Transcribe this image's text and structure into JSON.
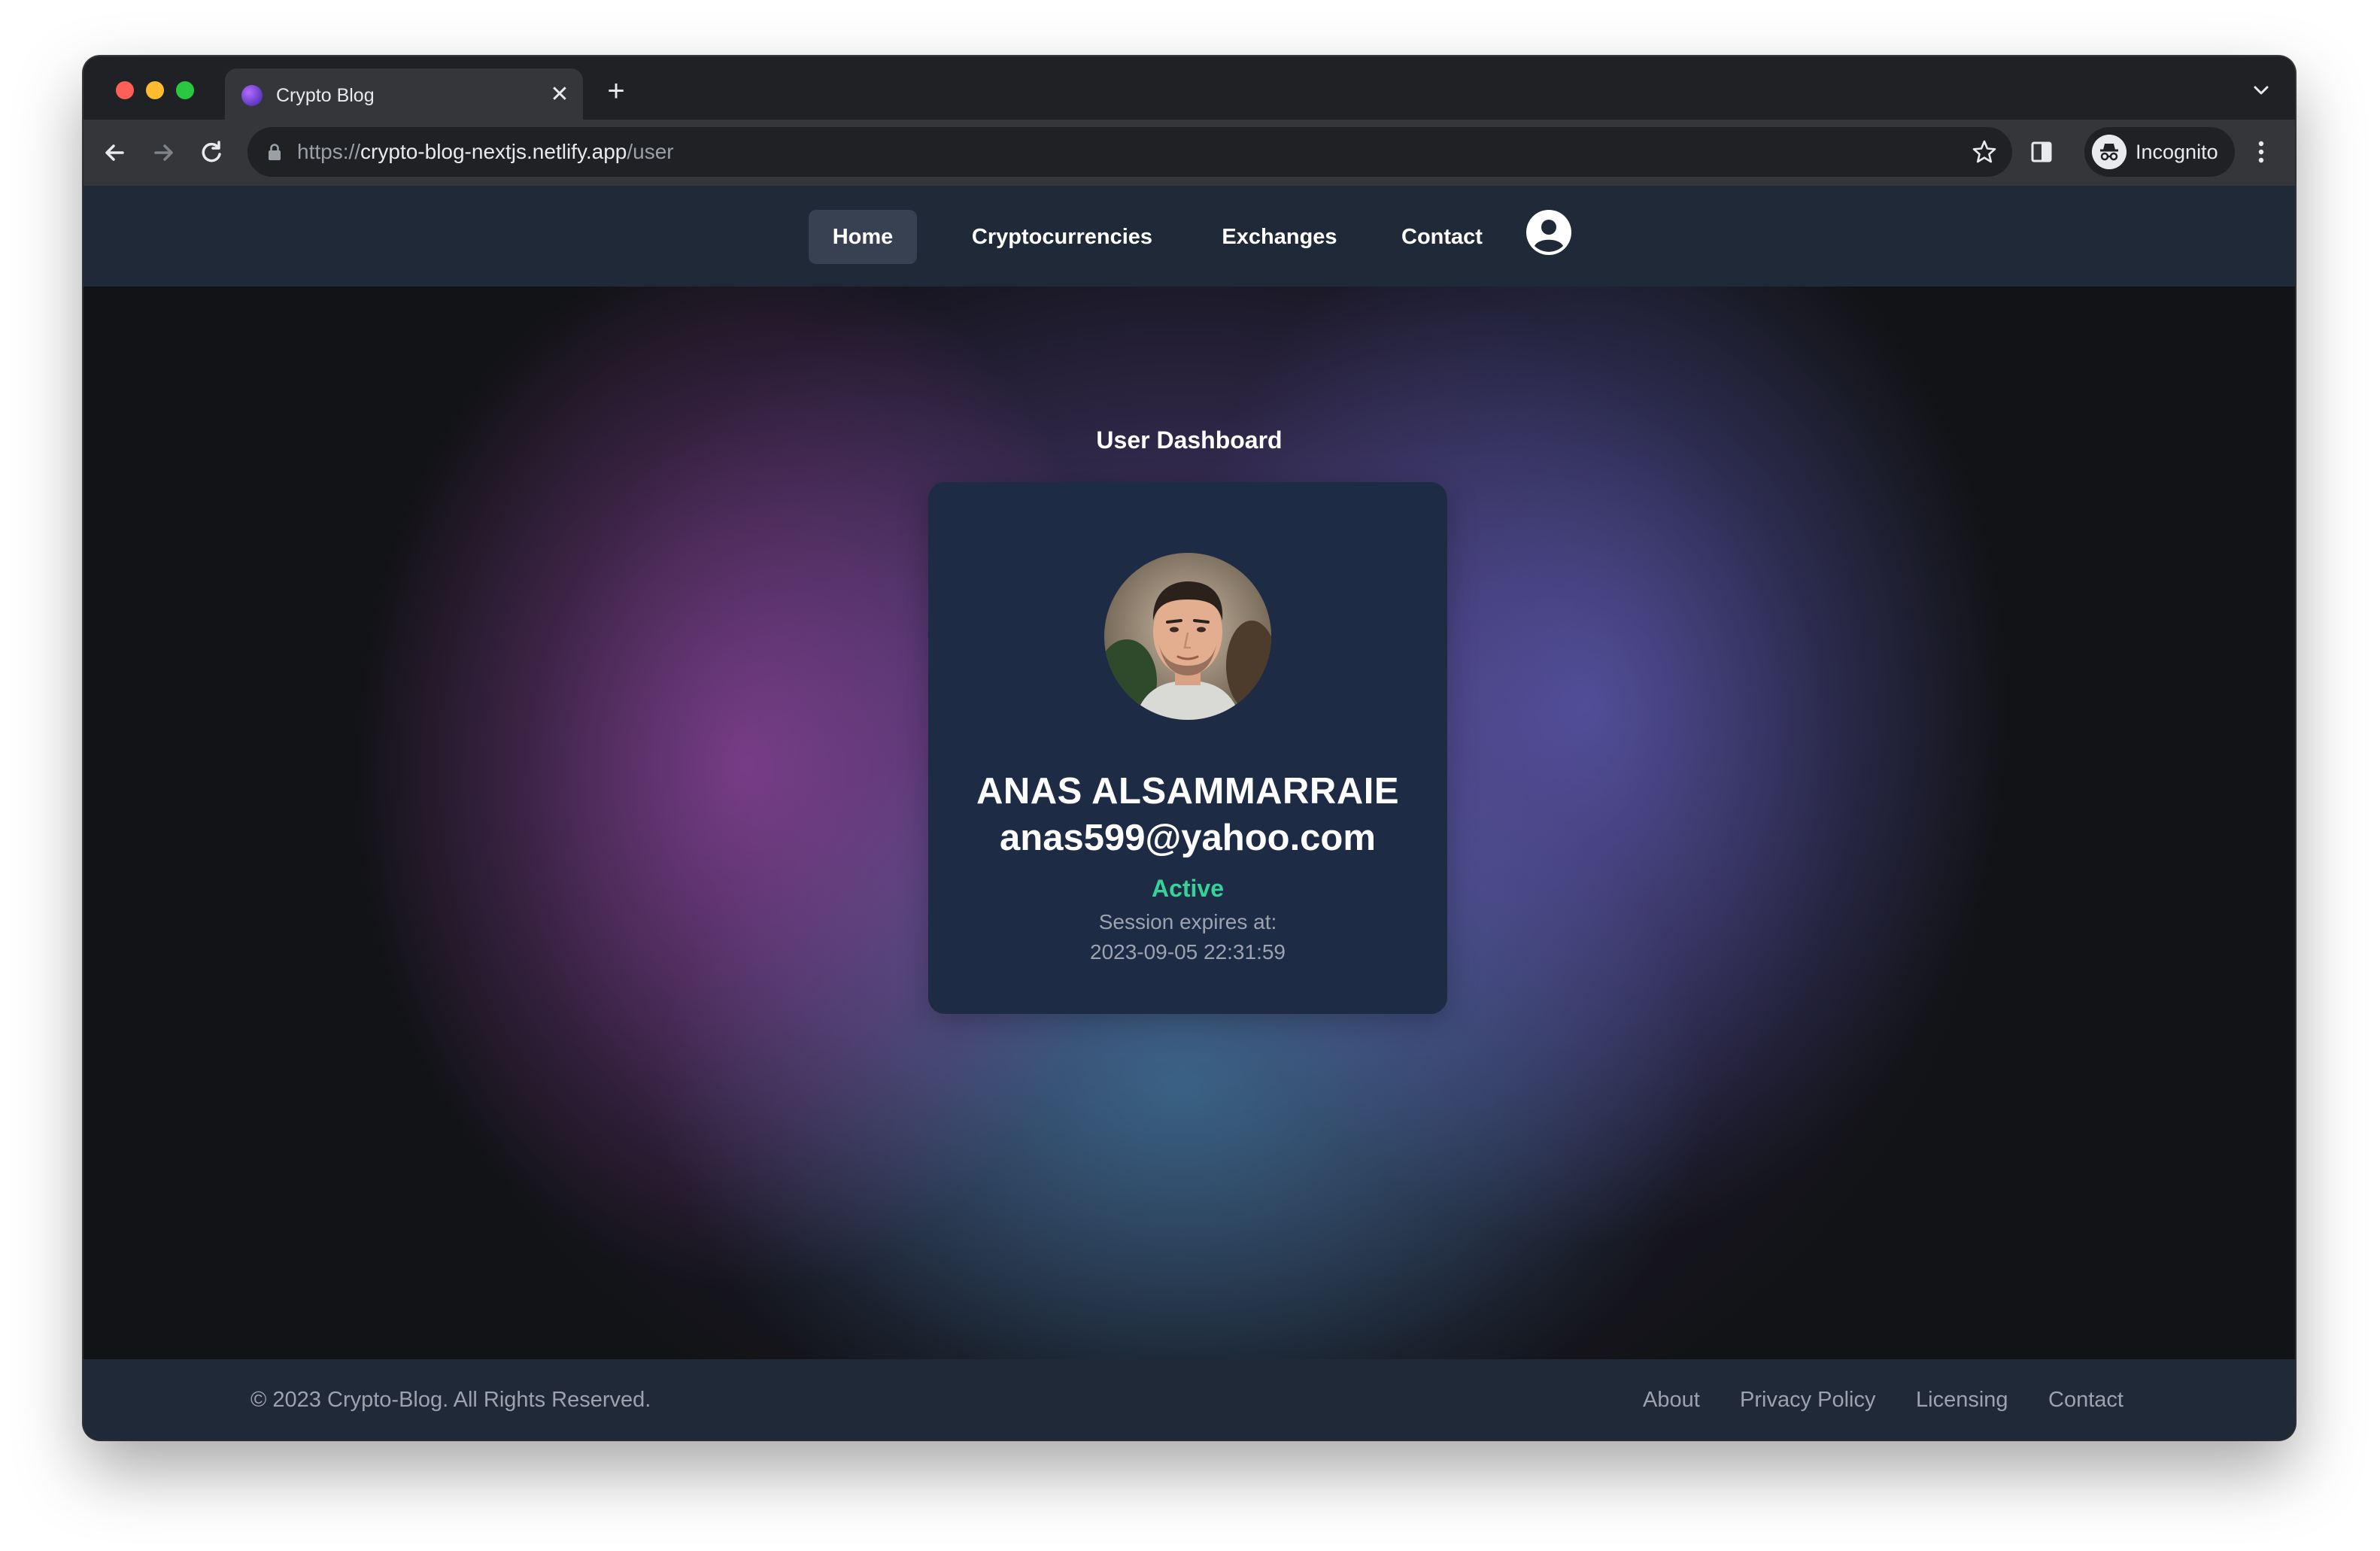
{
  "browser": {
    "tab_title": "Crypto Blog",
    "tab_close": "✕",
    "new_tab": "+",
    "url_scheme": "https://",
    "url_host": "crypto-blog-nextjs.netlify.app",
    "url_path": "/user",
    "profile_label": "Incognito"
  },
  "nav": {
    "items": [
      {
        "label": "Home",
        "active": true
      },
      {
        "label": "Cryptocurrencies",
        "active": false
      },
      {
        "label": "Exchanges",
        "active": false
      },
      {
        "label": "Contact",
        "active": false
      }
    ]
  },
  "dashboard": {
    "title": "User Dashboard",
    "name": "ANAS ALSAMMARRAIE",
    "email": "anas599@yahoo.com",
    "status": "Active",
    "session_label": "Session expires at:",
    "session_expires": "2023-09-05 22:31:59"
  },
  "footer": {
    "copyright": "© 2023 Crypto-Blog. All Rights Reserved.",
    "links": [
      "About",
      "Privacy Policy",
      "Licensing",
      "Contact"
    ]
  },
  "colors": {
    "navbar_bg": "#1f2937",
    "card_bg": "#1e2b45",
    "status_active": "#34d399",
    "muted_text": "#9ca3af"
  },
  "icons": {
    "back": "arrow-left-icon",
    "forward": "arrow-right-icon",
    "reload": "reload-icon",
    "lock": "lock-icon",
    "bookmark": "star-icon",
    "side_panel": "side-panel-icon",
    "incognito": "incognito-icon",
    "menu": "kebab-menu-icon",
    "profile": "user-circle-icon"
  }
}
